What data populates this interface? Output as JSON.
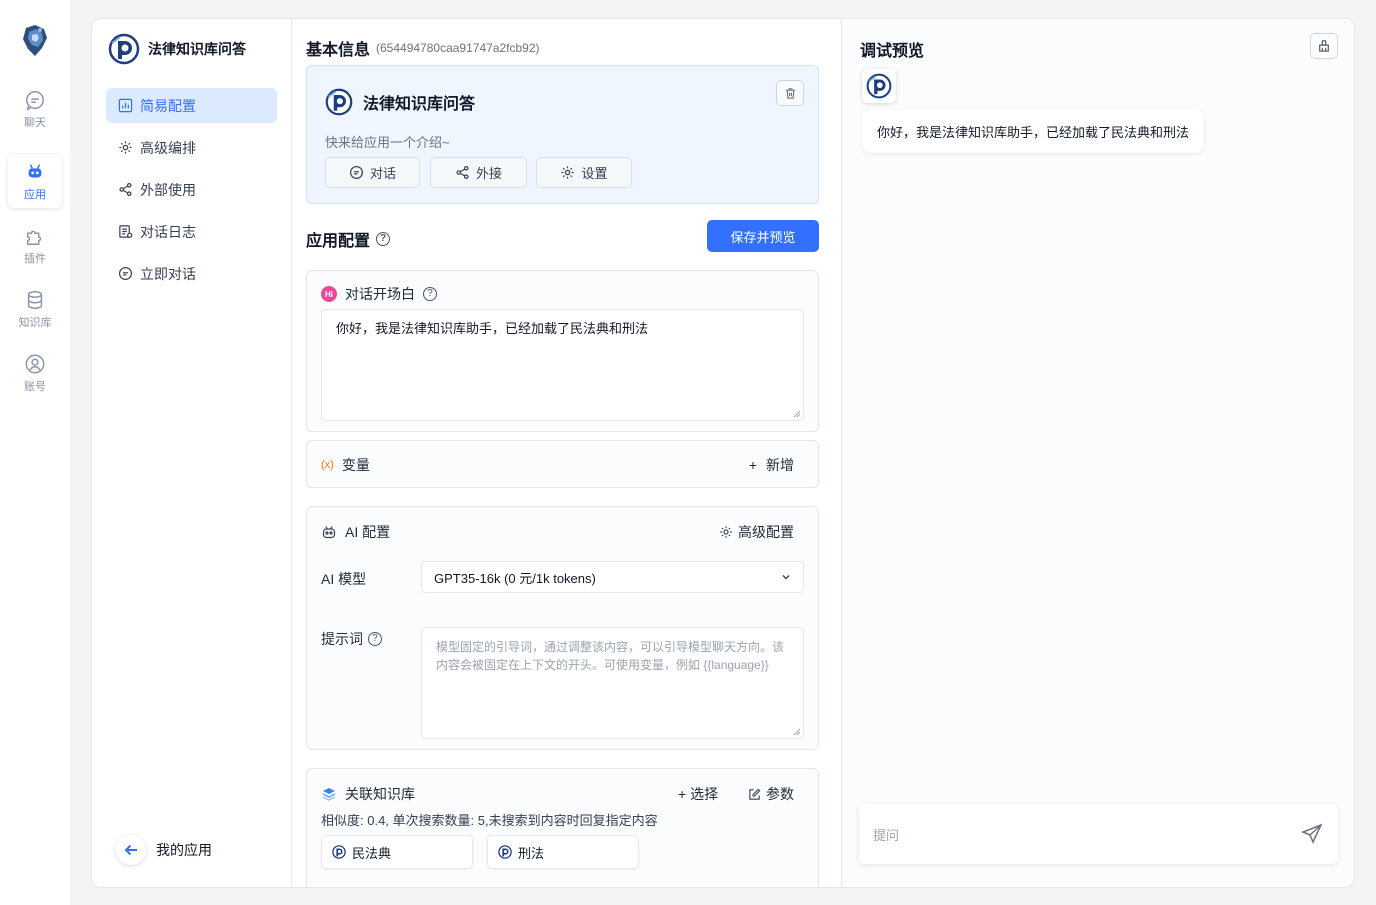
{
  "rail": {
    "items": [
      {
        "label": "聊天",
        "icon": "chat-icon"
      },
      {
        "label": "应用",
        "icon": "robot-icon",
        "active": true
      },
      {
        "label": "插件",
        "icon": "puzzle-icon"
      },
      {
        "label": "知识库",
        "icon": "database-icon"
      },
      {
        "label": "账号",
        "icon": "user-icon"
      }
    ]
  },
  "subnav": {
    "app_title": "法律知识库问答",
    "items": [
      {
        "label": "简易配置",
        "icon": "dashboard-icon",
        "active": true
      },
      {
        "label": "高级编排",
        "icon": "gear-icon"
      },
      {
        "label": "外部使用",
        "icon": "share-icon"
      },
      {
        "label": "对话日志",
        "icon": "log-icon"
      },
      {
        "label": "立即对话",
        "icon": "chat-icon"
      }
    ],
    "back_label": "我的应用"
  },
  "basic": {
    "title": "基本信息",
    "app_id": "(654494780caa91747a2fcb92)",
    "app_name": "法律知识库问答",
    "intro": "快来给应用一个介绍~",
    "buttons": [
      {
        "label": "对话",
        "icon": "chat-icon"
      },
      {
        "label": "外接",
        "icon": "share-icon"
      },
      {
        "label": "设置",
        "icon": "gear-icon"
      }
    ]
  },
  "app_config": {
    "title": "应用配置",
    "save_label": "保存并预览",
    "welcome": {
      "label": "对话开场白",
      "badge": "Hi",
      "value": "你好，我是法律知识库助手，已经加载了民法典和刑法"
    },
    "variables": {
      "label": "变量",
      "icon_text": "(x)",
      "add_label": "新增",
      "add_icon_text": "+"
    },
    "ai": {
      "label": "AI 配置",
      "advanced_label": "高级配置",
      "model_label": "AI 模型",
      "model_value": "GPT35-16k (0 元/1k tokens)",
      "prompt_label": "提示词",
      "prompt_placeholder": "模型固定的引导词，通过调整该内容，可以引导模型聊天方向。该内容会被固定在上下文的开头。可使用变量，例如 {{language}}"
    },
    "kb": {
      "label": "关联知识库",
      "select_label": "+ 选择",
      "params_label": "参数",
      "summary": "相似度: 0.4, 单次搜索数量: 5,未搜索到内容时回复指定内容",
      "items": [
        "民法典",
        "刑法"
      ]
    }
  },
  "preview": {
    "title": "调试预览",
    "greeting": "你好，我是法律知识库助手，已经加载了民法典和刑法",
    "input_placeholder": "提问"
  },
  "colors": {
    "accent": "#3370ff",
    "active_bg": "#dbeafe",
    "info_bg": "#f0f6ff",
    "variable_orange": "#f97316",
    "hi_badge": "#ec4899"
  }
}
